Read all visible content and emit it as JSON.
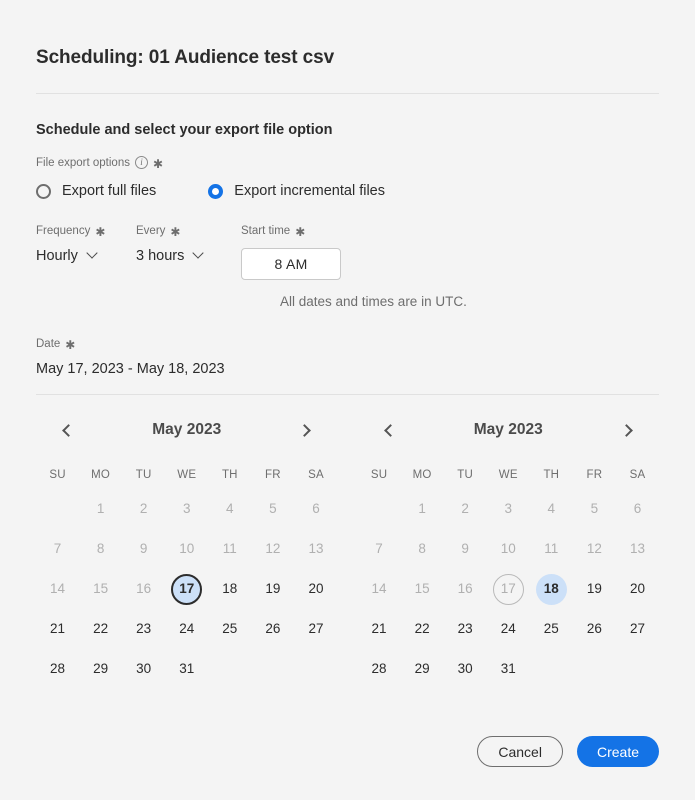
{
  "dialog": {
    "title": "Scheduling: 01 Audience test csv",
    "section_heading": "Schedule and select your export file option"
  },
  "export_options": {
    "label": "File export options",
    "info_icon": "info-icon",
    "required_marker": "✱",
    "options": [
      {
        "label": "Export full files",
        "selected": false
      },
      {
        "label": "Export incremental files",
        "selected": true
      }
    ]
  },
  "schedule": {
    "frequency": {
      "label": "Frequency",
      "value": "Hourly",
      "required_marker": "✱"
    },
    "every": {
      "label": "Every",
      "value": "3 hours",
      "required_marker": "✱"
    },
    "start_time": {
      "label": "Start time",
      "value": "8 AM",
      "required_marker": "✱"
    },
    "utc_note": "All dates and times are in UTC."
  },
  "date": {
    "label": "Date",
    "required_marker": "✱",
    "value": "May 17, 2023 - May 18, 2023"
  },
  "calendars": [
    {
      "name": "start-calendar",
      "month_title": "May 2023",
      "prev_label": "‹",
      "next_label": "›",
      "weekdays": [
        "SU",
        "MO",
        "TU",
        "WE",
        "TH",
        "FR",
        "SA"
      ],
      "lead_blanks": 1,
      "days": [
        {
          "n": "1",
          "state": "muted"
        },
        {
          "n": "2",
          "state": "muted"
        },
        {
          "n": "3",
          "state": "muted"
        },
        {
          "n": "4",
          "state": "muted"
        },
        {
          "n": "5",
          "state": "muted"
        },
        {
          "n": "6",
          "state": "muted"
        },
        {
          "n": "7",
          "state": "muted"
        },
        {
          "n": "8",
          "state": "muted"
        },
        {
          "n": "9",
          "state": "muted"
        },
        {
          "n": "10",
          "state": "muted"
        },
        {
          "n": "11",
          "state": "muted"
        },
        {
          "n": "12",
          "state": "muted"
        },
        {
          "n": "13",
          "state": "muted"
        },
        {
          "n": "14",
          "state": "muted"
        },
        {
          "n": "15",
          "state": "muted"
        },
        {
          "n": "16",
          "state": "muted"
        },
        {
          "n": "17",
          "state": "focusring"
        },
        {
          "n": "18",
          "state": "normal"
        },
        {
          "n": "19",
          "state": "normal"
        },
        {
          "n": "20",
          "state": "normal"
        },
        {
          "n": "21",
          "state": "normal"
        },
        {
          "n": "22",
          "state": "normal"
        },
        {
          "n": "23",
          "state": "normal"
        },
        {
          "n": "24",
          "state": "normal"
        },
        {
          "n": "25",
          "state": "normal"
        },
        {
          "n": "26",
          "state": "normal"
        },
        {
          "n": "27",
          "state": "normal"
        },
        {
          "n": "28",
          "state": "normal"
        },
        {
          "n": "29",
          "state": "normal"
        },
        {
          "n": "30",
          "state": "normal"
        },
        {
          "n": "31",
          "state": "normal"
        }
      ]
    },
    {
      "name": "end-calendar",
      "month_title": "May 2023",
      "prev_label": "‹",
      "next_label": "›",
      "weekdays": [
        "SU",
        "MO",
        "TU",
        "WE",
        "TH",
        "FR",
        "SA"
      ],
      "lead_blanks": 1,
      "days": [
        {
          "n": "1",
          "state": "muted"
        },
        {
          "n": "2",
          "state": "muted"
        },
        {
          "n": "3",
          "state": "muted"
        },
        {
          "n": "4",
          "state": "muted"
        },
        {
          "n": "5",
          "state": "muted"
        },
        {
          "n": "6",
          "state": "muted"
        },
        {
          "n": "7",
          "state": "muted"
        },
        {
          "n": "8",
          "state": "muted"
        },
        {
          "n": "9",
          "state": "muted"
        },
        {
          "n": "10",
          "state": "muted"
        },
        {
          "n": "11",
          "state": "muted"
        },
        {
          "n": "12",
          "state": "muted"
        },
        {
          "n": "13",
          "state": "muted"
        },
        {
          "n": "14",
          "state": "muted"
        },
        {
          "n": "15",
          "state": "muted"
        },
        {
          "n": "16",
          "state": "muted"
        },
        {
          "n": "17",
          "state": "todayring"
        },
        {
          "n": "18",
          "state": "selected"
        },
        {
          "n": "19",
          "state": "normal"
        },
        {
          "n": "20",
          "state": "normal"
        },
        {
          "n": "21",
          "state": "normal"
        },
        {
          "n": "22",
          "state": "normal"
        },
        {
          "n": "23",
          "state": "normal"
        },
        {
          "n": "24",
          "state": "normal"
        },
        {
          "n": "25",
          "state": "normal"
        },
        {
          "n": "26",
          "state": "normal"
        },
        {
          "n": "27",
          "state": "normal"
        },
        {
          "n": "28",
          "state": "normal"
        },
        {
          "n": "29",
          "state": "normal"
        },
        {
          "n": "30",
          "state": "normal"
        },
        {
          "n": "31",
          "state": "normal"
        }
      ]
    }
  ],
  "footer": {
    "cancel_label": "Cancel",
    "create_label": "Create"
  },
  "colors": {
    "accent": "#1473e6",
    "selected_day": "#cce0f8",
    "background": "#f4f4f4",
    "text": "#2c2c2c",
    "muted_text": "#6e6e6e"
  }
}
